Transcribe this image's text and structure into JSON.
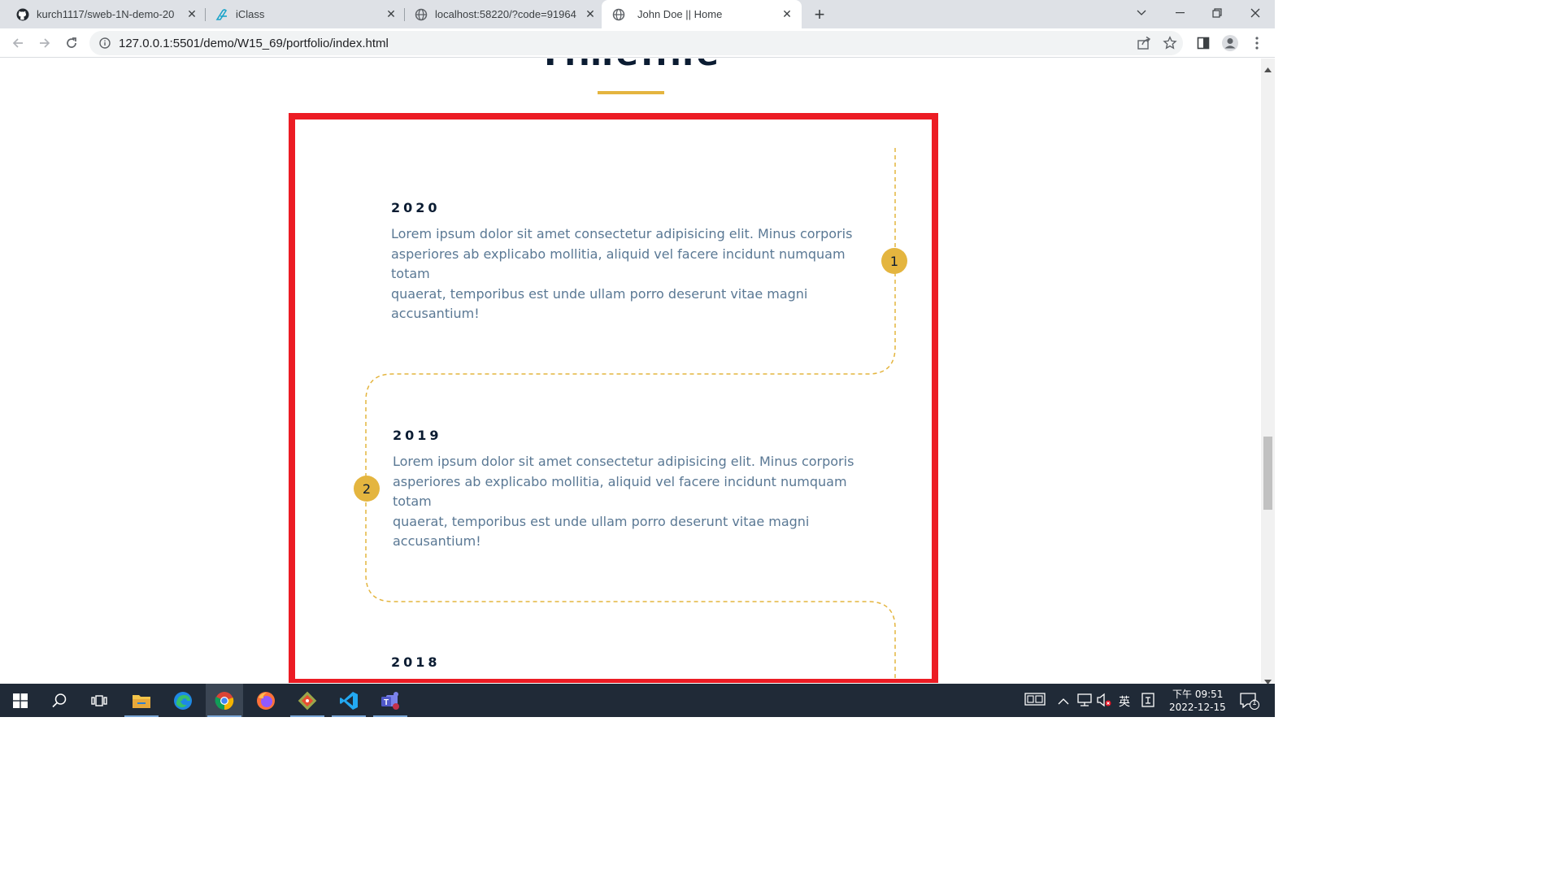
{
  "browser": {
    "tabs": [
      {
        "title": "kurch1117/sweb-1N-demo-20",
        "icon": "github-icon",
        "active": false
      },
      {
        "title": "iClass",
        "icon": "iclass-icon",
        "active": false
      },
      {
        "title": "localhost:58220/?code=91964",
        "icon": "globe-icon",
        "active": false
      },
      {
        "title": "John Doe || Home",
        "icon": "globe-icon",
        "active": true
      }
    ],
    "new_tab_label": "+",
    "url": "127.0.0.1:5501/demo/W15_69/portfolio/index.html"
  },
  "page": {
    "heading": "Timeline",
    "accent_color": "#e4b53f",
    "frame_color": "#ec1c24",
    "timeline": [
      {
        "number": "1",
        "year": "2020",
        "lines": [
          "Lorem ipsum dolor sit amet consectetur adipisicing elit. Minus corporis",
          "asperiores ab explicabo mollitia, aliquid vel facere incidunt numquam totam",
          "quaerat, temporibus est unde ullam porro deserunt vitae magni",
          "accusantium!"
        ]
      },
      {
        "number": "2",
        "year": "2019",
        "lines": [
          "Lorem ipsum dolor sit amet consectetur adipisicing elit. Minus corporis",
          "asperiores ab explicabo mollitia, aliquid vel facere incidunt numquam totam",
          "quaerat, temporibus est unde ullam porro deserunt vitae magni",
          "accusantium!"
        ]
      },
      {
        "year": "2018"
      }
    ]
  },
  "taskbar": {
    "apps": [
      "windows-start-icon",
      "search-icon",
      "task-view-icon",
      "file-explorer-icon",
      "edge-icon",
      "chrome-icon",
      "firefox-icon",
      "git-icon",
      "vscode-icon",
      "teams-icon"
    ],
    "ime_label": "英",
    "time": "下午 09:51",
    "date": "2022-12-15",
    "notification_count": "1"
  }
}
